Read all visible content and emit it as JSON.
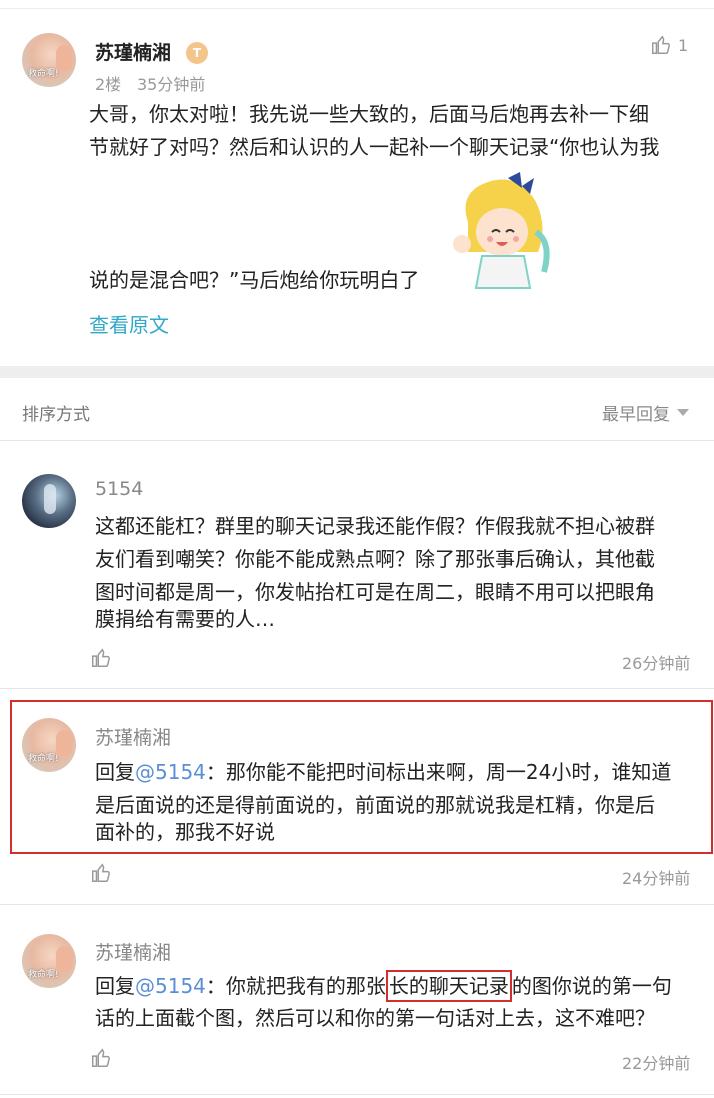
{
  "floor_post": {
    "username": "苏瑾楠湘",
    "level_badge": "T",
    "floor": "2楼",
    "time": "35分钟前",
    "like_count": "1",
    "text_line1": "大哥，你太对啦！我先说一些大致的，后面马后炮再去补一下细",
    "text_line2": "节就好了对吗？然后和认识的人一起补一个聊天记录“你也认为我",
    "text_line3": "说的是混合吧？”马后炮给你玩明白了",
    "view_original": "查看原文"
  },
  "sort_bar": {
    "label": "排序方式",
    "value": "最早回复"
  },
  "replies": [
    {
      "username": "5154",
      "line1": "这都还能杠？群里的聊天记录我还能作假？作假我就不担心被群",
      "line2": "友们看到嘲笑？你能不能成熟点啊？除了那张事后确认，其他截",
      "line3": "图时间都是周一，你发帖抬杠可是在周二，眼睛不用可以把眼角",
      "line4": "膜捐给有需要的人…",
      "time": "26分钟前"
    },
    {
      "username": "苏瑾楠湘",
      "reply_prefix": "回复",
      "mention": "@5154",
      "line1_rest": "：那你能不能把时间标出来啊，周一24小时，谁知道",
      "line2": "是后面说的还是得前面说的，前面说的那就说我是杠精，你是后",
      "line3": "面补的，那我不好说",
      "time": "24分钟前"
    },
    {
      "username": "苏瑾楠湘",
      "reply_prefix": "回复",
      "mention": "@5154",
      "line1_a": "：你就把我有的那张",
      "line1_highlight": "长的聊天记录",
      "line1_b": "的图你说的第一句",
      "line2": "话的上面截个图，然后可以和你的第一句话对上去，这不难吧？",
      "time": "22分钟前"
    }
  ],
  "avatar_caption": "救命啊!",
  "colors": {
    "highlight": "#d32e2e",
    "link": "#31a8c8",
    "mention": "#5a8fd6"
  }
}
